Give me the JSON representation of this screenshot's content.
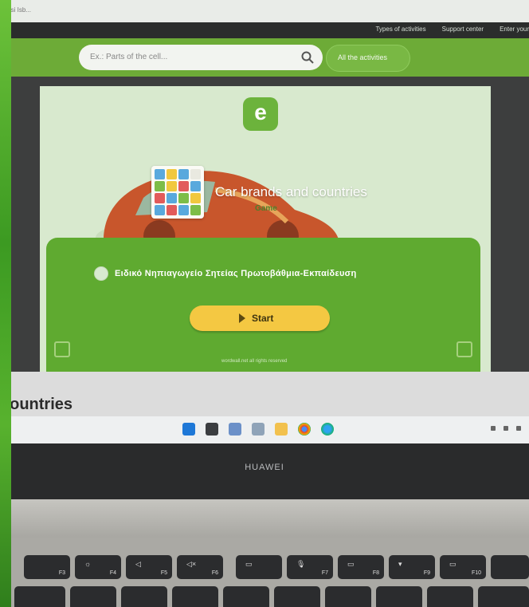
{
  "window": {
    "title_fragment": "Ipsi Isb..."
  },
  "site_nav": {
    "links": [
      "Types of activities",
      "Support center",
      "Enter your"
    ]
  },
  "search": {
    "placeholder": "Ex.: Parts of the cell...",
    "all_activities_label": "All the activities"
  },
  "activity": {
    "logo_letter": "e",
    "title": "Car brands and countries",
    "subtitle": "Game",
    "author": "Ειδικό Νηπιαγωγείο Σητείας Πρωτοβάθμια-Εκπαίδευση",
    "start_label": "Start",
    "footnote": "wordwall.net all rights reserved"
  },
  "page_heading": "countries",
  "taskbar": {
    "icons": [
      "windows-start-icon",
      "file-explorer-icon",
      "settings-icon",
      "task-view-icon",
      "folder-icon",
      "chrome-icon",
      "edge-icon"
    ]
  },
  "laptop": {
    "brand": "HUAWEI",
    "keys": [
      "F3",
      "F4",
      "F5",
      "F6",
      "F7",
      "F8",
      "F9",
      "F10"
    ]
  },
  "colors": {
    "accent_green": "#6dab37",
    "panel_green": "#5faa30",
    "start_yellow": "#f4c842",
    "nav_dark": "#2b2d2c"
  }
}
